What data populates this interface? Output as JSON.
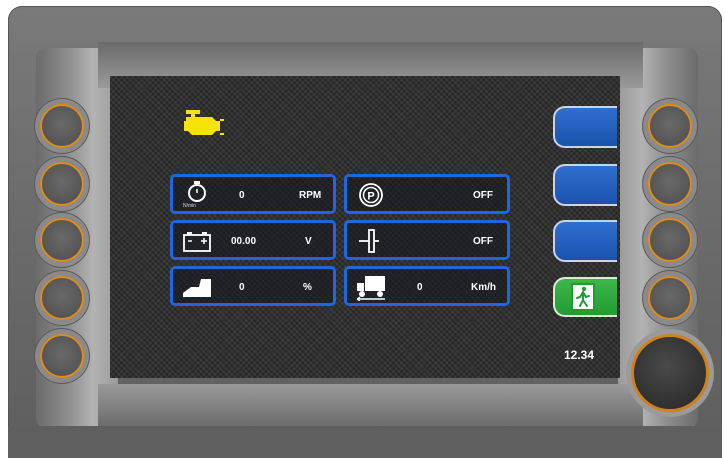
{
  "warnings": {
    "engine_icon": "check-engine-icon",
    "engine_color": "#f5e30a"
  },
  "gauges": {
    "rpm": {
      "value": "0",
      "unit": "RPM",
      "icon": "engine-speed-icon",
      "icon_label": "N/min"
    },
    "parking_brake": {
      "value": "OFF",
      "icon": "parking-brake-icon"
    },
    "battery": {
      "value": "00.00",
      "unit": "V",
      "icon": "battery-icon"
    },
    "pto": {
      "value": "OFF",
      "icon": "pto-icon"
    },
    "throttle": {
      "value": "0",
      "unit": "%",
      "icon": "pedal-icon"
    },
    "speed": {
      "value": "0",
      "unit": "Km/h",
      "icon": "truck-speed-icon"
    }
  },
  "soft_keys": [
    {
      "icon": "blank-key"
    },
    {
      "icon": "blank-key"
    },
    {
      "icon": "blank-key"
    },
    {
      "icon": "exit-icon",
      "color": "#2fa83c"
    }
  ],
  "clock": "12.34",
  "colors": {
    "tile_border": "#1f66e0",
    "key_blue": "#1b52ad",
    "bezel_orange": "#e08b1c"
  }
}
